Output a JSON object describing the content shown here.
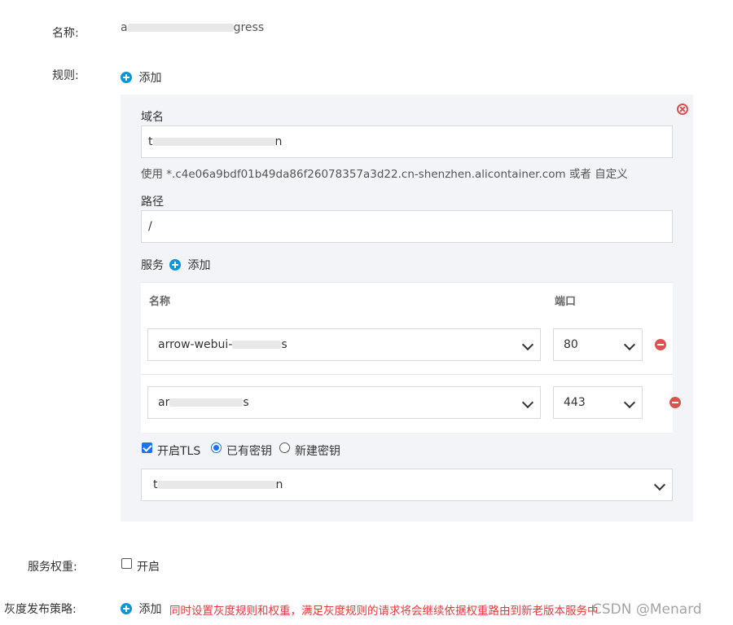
{
  "form": {
    "name_label": "名称:",
    "name_value_prefix": "a",
    "name_value_suffix": "gress",
    "rules_label": "规则:",
    "rules_add": "添加",
    "weight_label": "服务权重:",
    "weight_toggle_label": "开启",
    "gray_label": "灰度发布策略:",
    "gray_add": "添加",
    "gray_note": "同时设置灰度规则和权重，满足灰度规则的请求将会继续依据权重路由到新老版本服务中"
  },
  "rule": {
    "domain_label": "域名",
    "domain_value_prefix": "t",
    "domain_value_suffix": "n",
    "domain_hint": "使用 *.c4e06a9bdf01b49da86f26078357a3d22.cn-shenzhen.alicontainer.com 或者 自定义",
    "path_label": "路径",
    "path_value": "/",
    "service_label": "服务",
    "service_add": "添加",
    "table": {
      "col_name": "名称",
      "col_port": "端口",
      "rows": [
        {
          "name_prefix": "arrow-webui-",
          "name_suffix": "s",
          "port": "80"
        },
        {
          "name_prefix": "ar",
          "name_suffix": "s",
          "port": "443"
        }
      ]
    },
    "tls_label": "开启TLS",
    "existing_key_label": "已有密钥",
    "new_key_label": "新建密钥",
    "secret_value_prefix": "t",
    "secret_value_suffix": "n"
  },
  "watermark": "CSDN @Menard",
  "colors": {
    "accent_blue": "#0a95d8",
    "danger_red": "#d9534f",
    "note_red": "#e0393e",
    "panel_bg": "#f3f4f8"
  },
  "icons": {
    "add": "plus-circle-icon",
    "remove": "minus-circle-icon",
    "close": "close-circle-icon",
    "select": "chevron-down-icon"
  }
}
